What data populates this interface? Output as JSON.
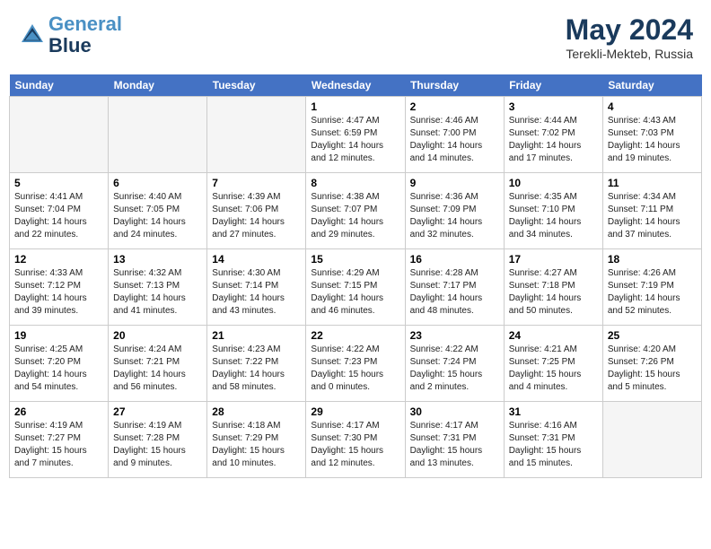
{
  "header": {
    "logo_line1": "General",
    "logo_line2": "Blue",
    "month": "May 2024",
    "location": "Terekli-Mekteb, Russia"
  },
  "days_of_week": [
    "Sunday",
    "Monday",
    "Tuesday",
    "Wednesday",
    "Thursday",
    "Friday",
    "Saturday"
  ],
  "weeks": [
    [
      {
        "day": "",
        "empty": true
      },
      {
        "day": "",
        "empty": true
      },
      {
        "day": "",
        "empty": true
      },
      {
        "day": "1",
        "sunrise": "Sunrise: 4:47 AM",
        "sunset": "Sunset: 6:59 PM",
        "daylight": "Daylight: 14 hours and 12 minutes."
      },
      {
        "day": "2",
        "sunrise": "Sunrise: 4:46 AM",
        "sunset": "Sunset: 7:00 PM",
        "daylight": "Daylight: 14 hours and 14 minutes."
      },
      {
        "day": "3",
        "sunrise": "Sunrise: 4:44 AM",
        "sunset": "Sunset: 7:02 PM",
        "daylight": "Daylight: 14 hours and 17 minutes."
      },
      {
        "day": "4",
        "sunrise": "Sunrise: 4:43 AM",
        "sunset": "Sunset: 7:03 PM",
        "daylight": "Daylight: 14 hours and 19 minutes."
      }
    ],
    [
      {
        "day": "5",
        "sunrise": "Sunrise: 4:41 AM",
        "sunset": "Sunset: 7:04 PM",
        "daylight": "Daylight: 14 hours and 22 minutes."
      },
      {
        "day": "6",
        "sunrise": "Sunrise: 4:40 AM",
        "sunset": "Sunset: 7:05 PM",
        "daylight": "Daylight: 14 hours and 24 minutes."
      },
      {
        "day": "7",
        "sunrise": "Sunrise: 4:39 AM",
        "sunset": "Sunset: 7:06 PM",
        "daylight": "Daylight: 14 hours and 27 minutes."
      },
      {
        "day": "8",
        "sunrise": "Sunrise: 4:38 AM",
        "sunset": "Sunset: 7:07 PM",
        "daylight": "Daylight: 14 hours and 29 minutes."
      },
      {
        "day": "9",
        "sunrise": "Sunrise: 4:36 AM",
        "sunset": "Sunset: 7:09 PM",
        "daylight": "Daylight: 14 hours and 32 minutes."
      },
      {
        "day": "10",
        "sunrise": "Sunrise: 4:35 AM",
        "sunset": "Sunset: 7:10 PM",
        "daylight": "Daylight: 14 hours and 34 minutes."
      },
      {
        "day": "11",
        "sunrise": "Sunrise: 4:34 AM",
        "sunset": "Sunset: 7:11 PM",
        "daylight": "Daylight: 14 hours and 37 minutes."
      }
    ],
    [
      {
        "day": "12",
        "sunrise": "Sunrise: 4:33 AM",
        "sunset": "Sunset: 7:12 PM",
        "daylight": "Daylight: 14 hours and 39 minutes."
      },
      {
        "day": "13",
        "sunrise": "Sunrise: 4:32 AM",
        "sunset": "Sunset: 7:13 PM",
        "daylight": "Daylight: 14 hours and 41 minutes."
      },
      {
        "day": "14",
        "sunrise": "Sunrise: 4:30 AM",
        "sunset": "Sunset: 7:14 PM",
        "daylight": "Daylight: 14 hours and 43 minutes."
      },
      {
        "day": "15",
        "sunrise": "Sunrise: 4:29 AM",
        "sunset": "Sunset: 7:15 PM",
        "daylight": "Daylight: 14 hours and 46 minutes."
      },
      {
        "day": "16",
        "sunrise": "Sunrise: 4:28 AM",
        "sunset": "Sunset: 7:17 PM",
        "daylight": "Daylight: 14 hours and 48 minutes."
      },
      {
        "day": "17",
        "sunrise": "Sunrise: 4:27 AM",
        "sunset": "Sunset: 7:18 PM",
        "daylight": "Daylight: 14 hours and 50 minutes."
      },
      {
        "day": "18",
        "sunrise": "Sunrise: 4:26 AM",
        "sunset": "Sunset: 7:19 PM",
        "daylight": "Daylight: 14 hours and 52 minutes."
      }
    ],
    [
      {
        "day": "19",
        "sunrise": "Sunrise: 4:25 AM",
        "sunset": "Sunset: 7:20 PM",
        "daylight": "Daylight: 14 hours and 54 minutes."
      },
      {
        "day": "20",
        "sunrise": "Sunrise: 4:24 AM",
        "sunset": "Sunset: 7:21 PM",
        "daylight": "Daylight: 14 hours and 56 minutes."
      },
      {
        "day": "21",
        "sunrise": "Sunrise: 4:23 AM",
        "sunset": "Sunset: 7:22 PM",
        "daylight": "Daylight: 14 hours and 58 minutes."
      },
      {
        "day": "22",
        "sunrise": "Sunrise: 4:22 AM",
        "sunset": "Sunset: 7:23 PM",
        "daylight": "Daylight: 15 hours and 0 minutes."
      },
      {
        "day": "23",
        "sunrise": "Sunrise: 4:22 AM",
        "sunset": "Sunset: 7:24 PM",
        "daylight": "Daylight: 15 hours and 2 minutes."
      },
      {
        "day": "24",
        "sunrise": "Sunrise: 4:21 AM",
        "sunset": "Sunset: 7:25 PM",
        "daylight": "Daylight: 15 hours and 4 minutes."
      },
      {
        "day": "25",
        "sunrise": "Sunrise: 4:20 AM",
        "sunset": "Sunset: 7:26 PM",
        "daylight": "Daylight: 15 hours and 5 minutes."
      }
    ],
    [
      {
        "day": "26",
        "sunrise": "Sunrise: 4:19 AM",
        "sunset": "Sunset: 7:27 PM",
        "daylight": "Daylight: 15 hours and 7 minutes."
      },
      {
        "day": "27",
        "sunrise": "Sunrise: 4:19 AM",
        "sunset": "Sunset: 7:28 PM",
        "daylight": "Daylight: 15 hours and 9 minutes."
      },
      {
        "day": "28",
        "sunrise": "Sunrise: 4:18 AM",
        "sunset": "Sunset: 7:29 PM",
        "daylight": "Daylight: 15 hours and 10 minutes."
      },
      {
        "day": "29",
        "sunrise": "Sunrise: 4:17 AM",
        "sunset": "Sunset: 7:30 PM",
        "daylight": "Daylight: 15 hours and 12 minutes."
      },
      {
        "day": "30",
        "sunrise": "Sunrise: 4:17 AM",
        "sunset": "Sunset: 7:31 PM",
        "daylight": "Daylight: 15 hours and 13 minutes."
      },
      {
        "day": "31",
        "sunrise": "Sunrise: 4:16 AM",
        "sunset": "Sunset: 7:31 PM",
        "daylight": "Daylight: 15 hours and 15 minutes."
      },
      {
        "day": "",
        "empty": true
      }
    ]
  ]
}
